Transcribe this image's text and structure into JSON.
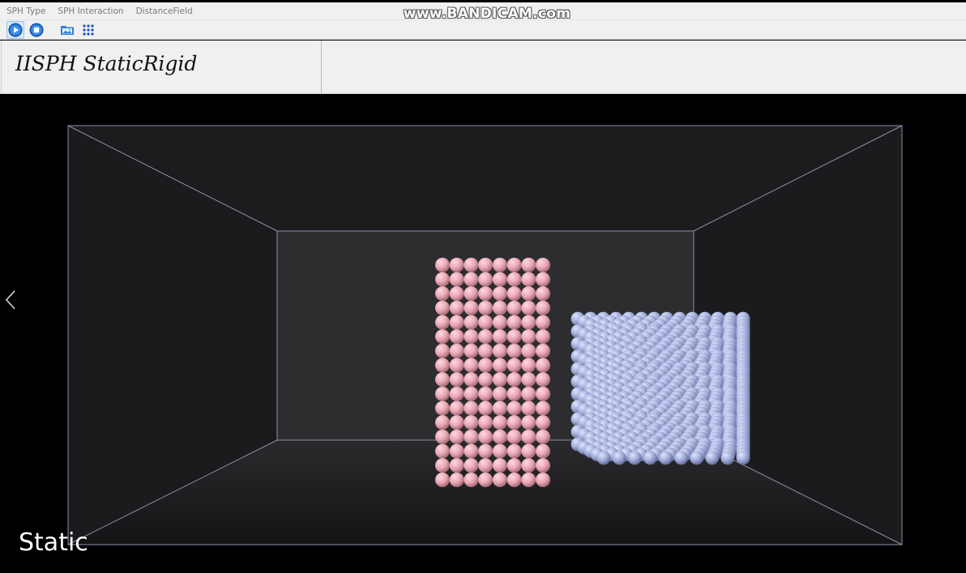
{
  "menu": {
    "items": [
      {
        "label": "SPH Type"
      },
      {
        "label": "SPH Interaction"
      },
      {
        "label": "DistanceField"
      }
    ]
  },
  "watermark": "www.BANDICAM.com",
  "toolbar": {
    "buttons": [
      {
        "icon": "play-icon",
        "active": true
      },
      {
        "icon": "stop-icon",
        "active": false
      },
      {
        "icon": "folder-image-icon",
        "active": false
      },
      {
        "icon": "grid-dots-icon",
        "active": false
      }
    ]
  },
  "scene": {
    "title": "IISPH StaticRigid",
    "status": "Static",
    "colors": {
      "room_wall": "#1e1e21",
      "room_back": "#2d2d30",
      "room_edge": "#8e8ea8",
      "fluid_particles": "#e9a6b5",
      "rigid_particles": "#9fa9d6"
    }
  }
}
